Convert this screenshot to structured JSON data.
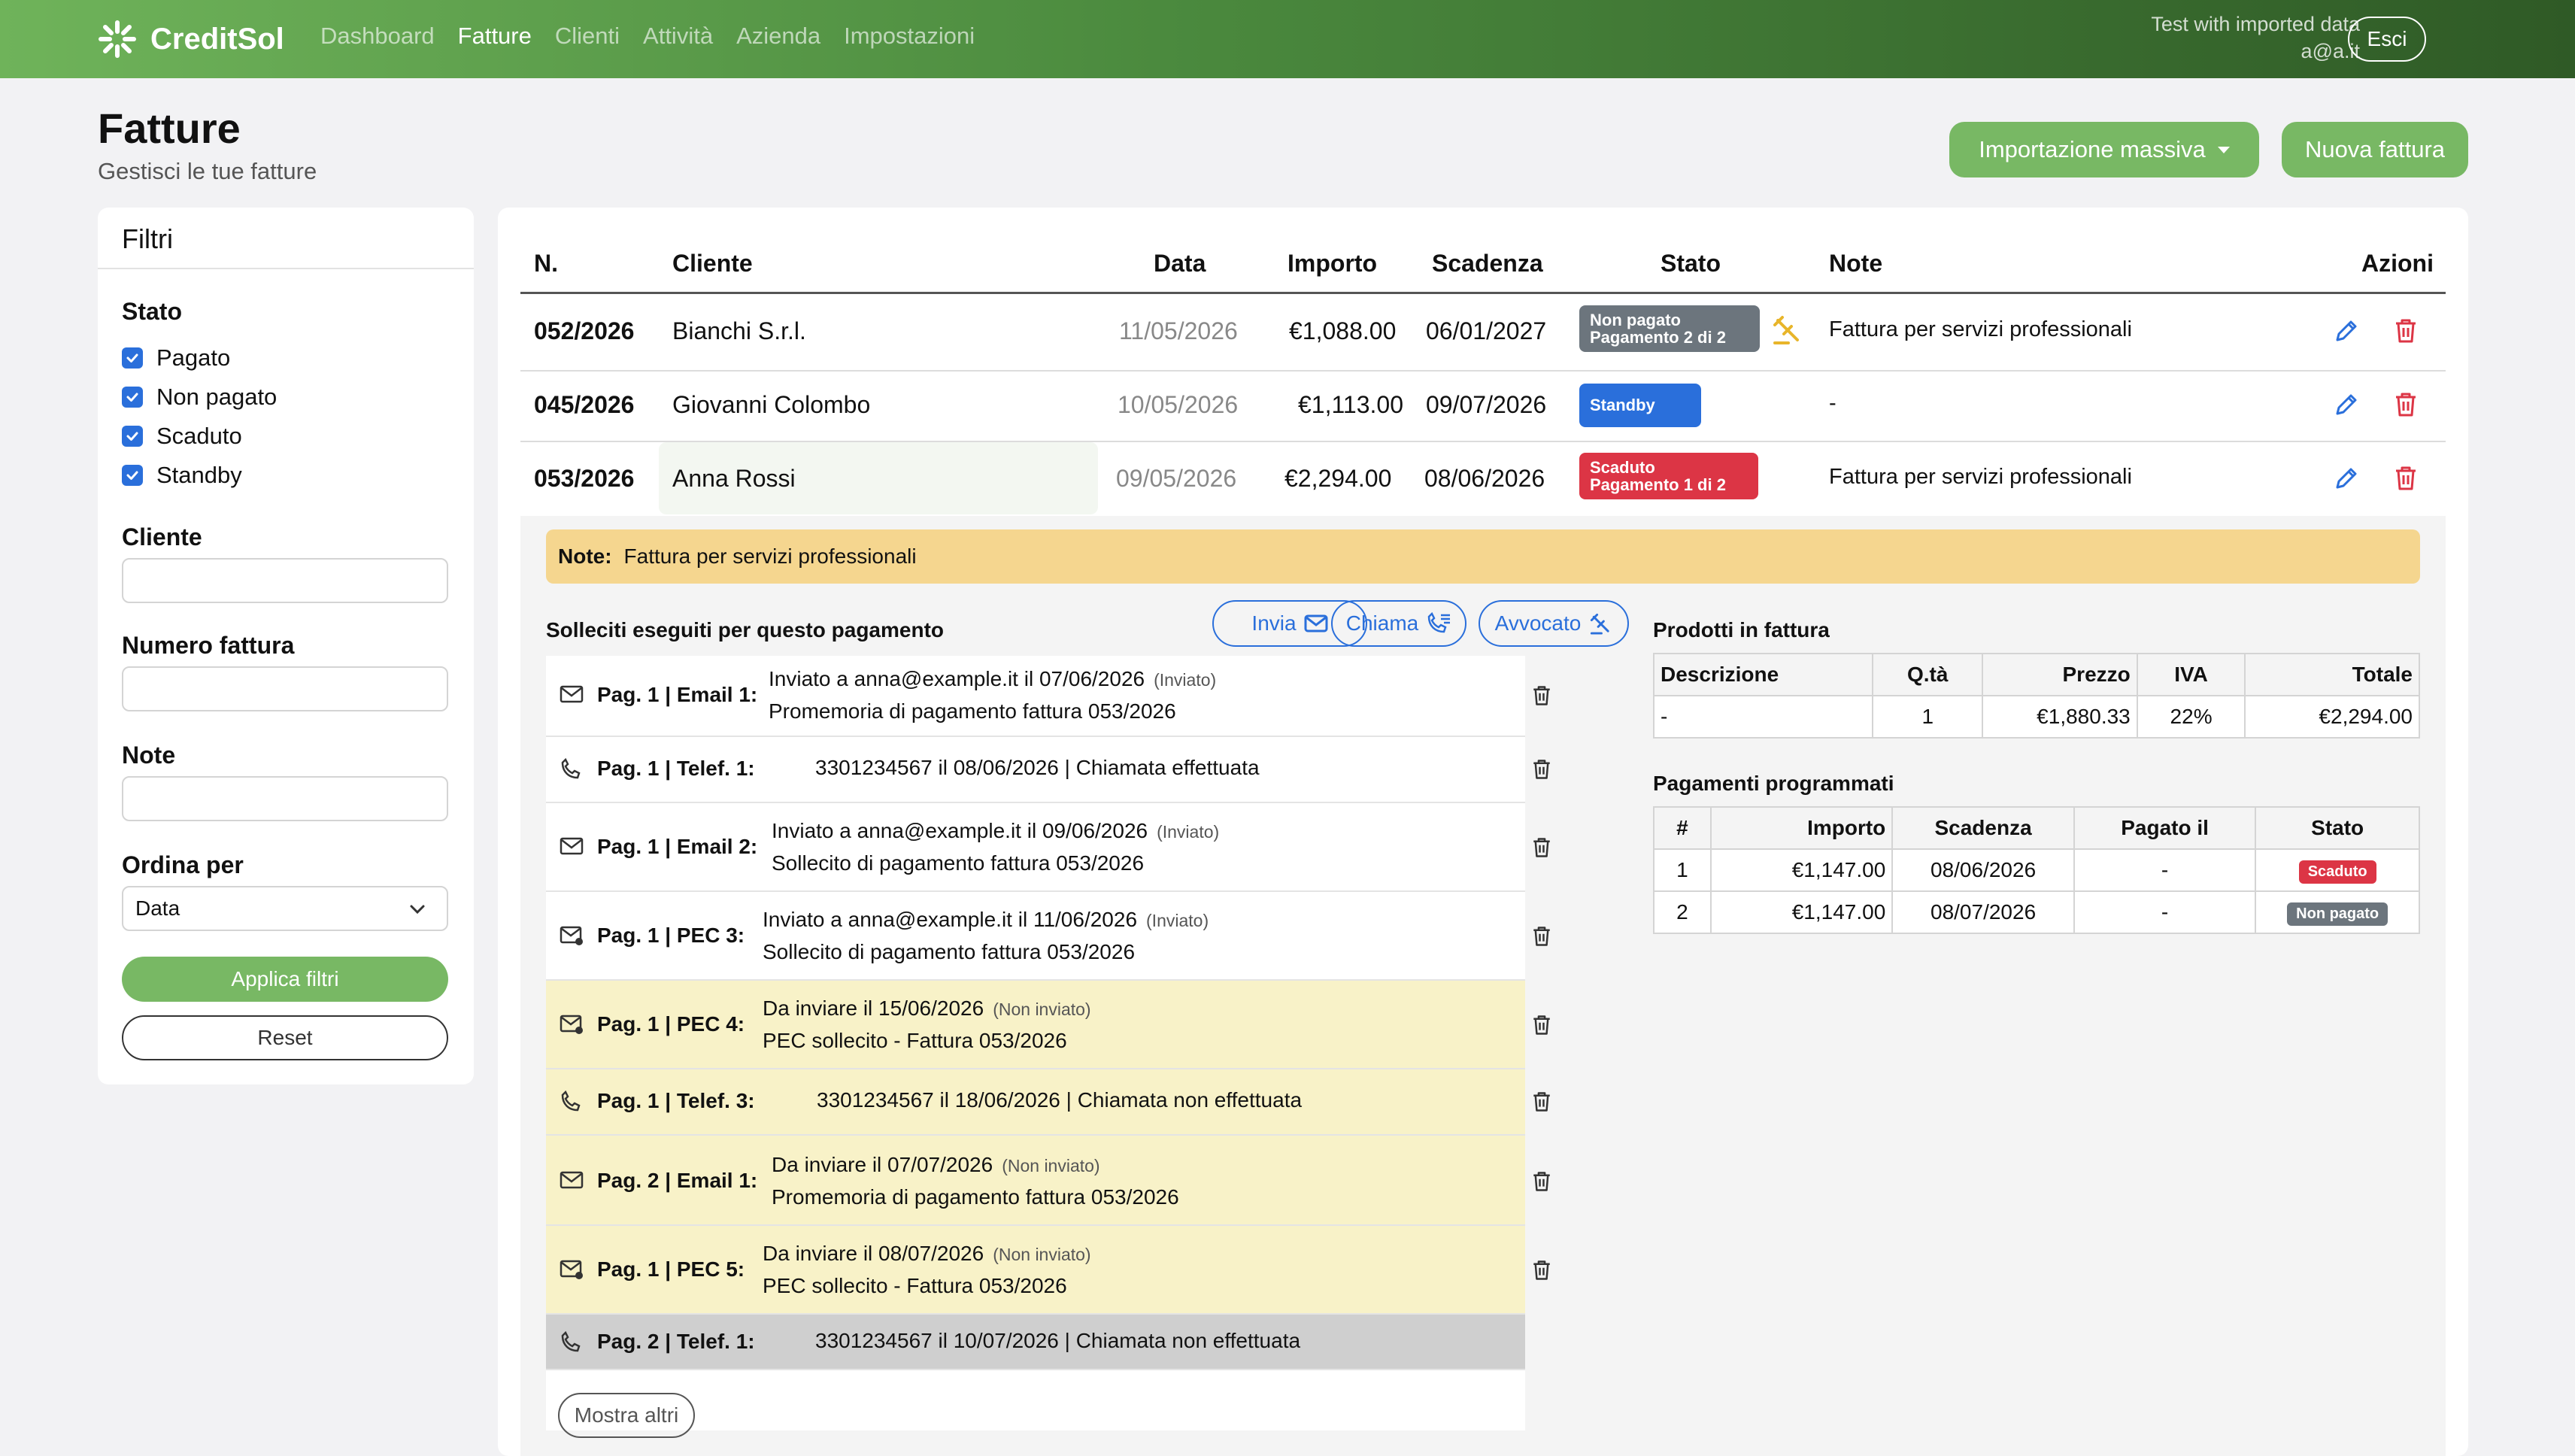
{
  "app": {
    "brand": "CreditSol"
  },
  "nav": {
    "items": [
      "Dashboard",
      "Fatture",
      "Clienti",
      "Attività",
      "Azienda",
      "Impostazioni"
    ],
    "active": "Fatture"
  },
  "user": {
    "org": "Test with imported data",
    "email": "a@a.it",
    "logout": "Esci"
  },
  "page": {
    "title": "Fatture",
    "subtitle": "Gestisci le tue fatture",
    "import_button": "Importazione massiva",
    "new_button": "Nuova fattura"
  },
  "filters": {
    "title": "Filtri",
    "status_label": "Stato",
    "statuses": [
      "Pagato",
      "Non pagato",
      "Scaduto",
      "Standby"
    ],
    "client_label": "Cliente",
    "invoice_label": "Numero fattura",
    "note_label": "Note",
    "sort_label": "Ordina per",
    "sort_value": "Data",
    "apply": "Applica filtri",
    "reset": "Reset"
  },
  "table": {
    "headers": {
      "n": "N.",
      "client": "Cliente",
      "date": "Data",
      "amount": "Importo",
      "due": "Scadenza",
      "status": "Stato",
      "notes": "Note",
      "actions": "Azioni"
    },
    "rows": [
      {
        "n": "052/2026",
        "client": "Bianchi S.r.l.",
        "date": "11/05/2026",
        "amount": "€1,088.00",
        "due": "06/01/2027",
        "status1": "Non pagato",
        "status2": "Pagamento 2 di 2",
        "note": "Fattura per servizi professionali"
      },
      {
        "n": "045/2026",
        "client": "Giovanni Colombo",
        "date": "10/05/2026",
        "amount": "€1,113.00",
        "due": "09/07/2026",
        "status1": "Standby",
        "status2": "",
        "note": "-"
      },
      {
        "n": "053/2026",
        "client": "Anna Rossi",
        "date": "09/05/2026",
        "amount": "€2,294.00",
        "due": "08/06/2026",
        "status1": "Scaduto",
        "status2": "Pagamento 1 di 2",
        "note": "Fattura per servizi professionali"
      }
    ]
  },
  "detail": {
    "note_label": "Note:",
    "note_text": "Fattura per servizi professionali",
    "reminders_title": "Solleciti eseguiti per questo pagamento",
    "btn_send": "Invia",
    "btn_call": "Chiama",
    "btn_lawyer": "Avvocato",
    "reminders": [
      {
        "icon": "email",
        "label": "Pag. 1 | Email 1:",
        "line1": "Inviato a anna@example.it il 07/06/2026",
        "status": "(Inviato)",
        "line2": "Promemoria di pagamento fattura 053/2026"
      },
      {
        "icon": "phone",
        "label": "Pag. 1 | Telef. 1:",
        "line1": "3301234567 il 08/06/2026 | Chiamata effettuata",
        "status": "",
        "line2": ""
      },
      {
        "icon": "email",
        "label": "Pag. 1 | Email 2:",
        "line1": "Inviato a anna@example.it il 09/06/2026",
        "status": "(Inviato)",
        "line2": "Sollecito di pagamento fattura 053/2026"
      },
      {
        "icon": "pec",
        "label": "Pag. 1 | PEC  3:",
        "line1": "Inviato a anna@example.it il 11/06/2026",
        "status": "(Inviato)",
        "line2": "Sollecito di pagamento fattura 053/2026"
      },
      {
        "icon": "pec",
        "label": "Pag. 1 | PEC  4:",
        "line1": "Da inviare il 15/06/2026",
        "status": "(Non inviato)",
        "line2": "PEC sollecito - Fattura 053/2026"
      },
      {
        "icon": "phone",
        "label": "Pag. 1 | Telef. 3:",
        "line1": "3301234567 il 18/06/2026 | Chiamata non effettuata",
        "status": "",
        "line2": ""
      },
      {
        "icon": "email",
        "label": "Pag. 2 | Email 1:",
        "line1": "Da inviare il 07/07/2026",
        "status": "(Non inviato)",
        "line2": "Promemoria di pagamento fattura 053/2026"
      },
      {
        "icon": "pec",
        "label": "Pag. 1 | PEC  5:",
        "line1": "Da inviare il 08/07/2026",
        "status": "(Non inviato)",
        "line2": "PEC sollecito - Fattura 053/2026"
      },
      {
        "icon": "phone",
        "label": "Pag. 2 | Telef. 1:",
        "line1": "3301234567 il 10/07/2026 | Chiamata non effettuata",
        "status": "",
        "line2": ""
      }
    ],
    "more_button": "Mostra altri",
    "products_title": "Prodotti in fattura",
    "products_headers": [
      "Descrizione",
      "Q.tà",
      "Prezzo",
      "IVA",
      "Totale"
    ],
    "products": [
      {
        "desc": "-",
        "qty": "1",
        "price": "€1,880.33",
        "vat": "22%",
        "total": "€2,294.00"
      }
    ],
    "payments_title": "Pagamenti programmati",
    "payments_headers": [
      "#",
      "Importo",
      "Scadenza",
      "Pagato il",
      "Stato"
    ],
    "payments": [
      {
        "n": "1",
        "amount": "€1,147.00",
        "due": "08/06/2026",
        "paid": "-",
        "status": "Scaduto"
      },
      {
        "n": "2",
        "amount": "€1,147.00",
        "due": "08/07/2026",
        "paid": "-",
        "status": "Non pagato"
      }
    ]
  },
  "colors": {
    "accent_green": "#78b864",
    "blue": "#2a6fdb",
    "red": "#dc3545",
    "gray_badge": "#6c757d",
    "note_bg": "#f5d68f",
    "pending_bg": "#f8f2c8"
  }
}
